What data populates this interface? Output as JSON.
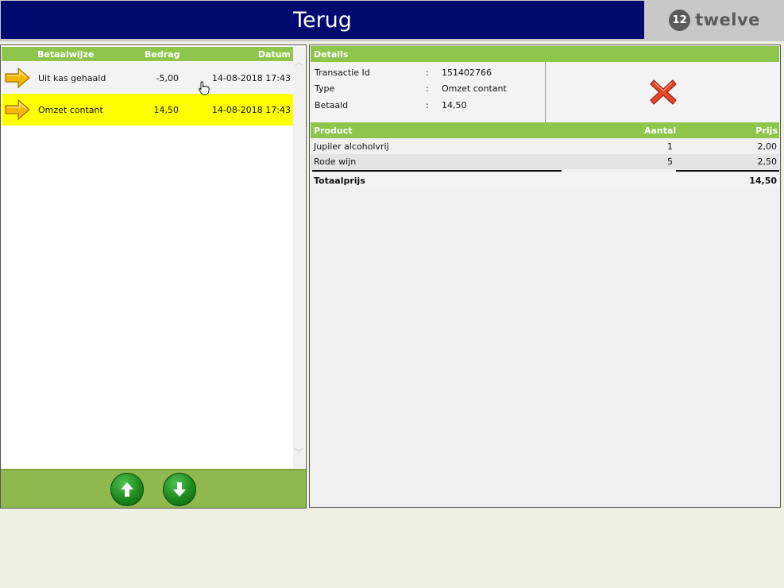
{
  "header": {
    "back_label": "Terug",
    "brand_name": "twelve",
    "brand_mark": "12",
    "back_color": "#000a6e"
  },
  "transactions": {
    "columns": {
      "method": "Betaalwijze",
      "amount": "Bedrag",
      "date": "Datum"
    },
    "rows": [
      {
        "method": "Uit kas gehaald",
        "amount": "-5,00",
        "date": "14-08-2018 17:43",
        "selected": false
      },
      {
        "method": "Omzet contant",
        "amount": "14,50",
        "date": "14-08-2018 17:43",
        "selected": true
      }
    ],
    "selected_color": "#ffff00",
    "arrow_icon": "arrow-right-icon"
  },
  "navigation": {
    "up_icon": "arrow-up-icon",
    "down_icon": "arrow-down-icon"
  },
  "details": {
    "title": "Details",
    "fields": [
      {
        "label": "Transactie Id",
        "sep": ":",
        "value": "151402766"
      },
      {
        "label": "Type",
        "sep": ":",
        "value": "Omzet contant"
      },
      {
        "label": "Betaald",
        "sep": ":",
        "value": "14,50"
      }
    ],
    "close_icon": "red-x-icon"
  },
  "products": {
    "columns": {
      "name": "Product",
      "qty": "Aantal",
      "price": "Prijs"
    },
    "rows": [
      {
        "name": "Jupiler alcoholvrij",
        "qty": "1",
        "price": "2,00"
      },
      {
        "name": "Rode wijn",
        "qty": "5",
        "price": "2,50"
      }
    ],
    "total_label": "Totaalprijs",
    "total_value": "14,50"
  },
  "colors": {
    "accent_green": "#8ec64b",
    "nav_green": "#8fb94e"
  }
}
